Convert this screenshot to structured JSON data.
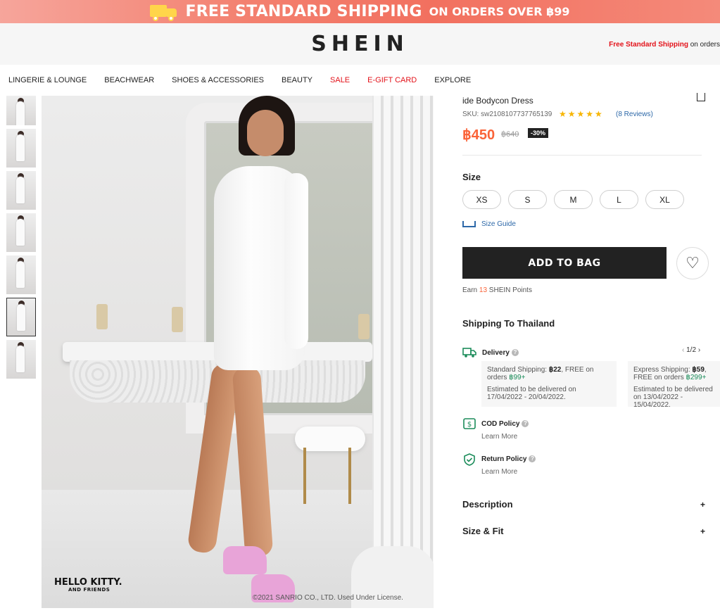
{
  "promo": {
    "main": "FREE STANDARD SHIPPING",
    "sub": "ON ORDERS OVER ฿99",
    "icon": "truck-icon",
    "accent": "#f2705f"
  },
  "header": {
    "logo": "SHEIN",
    "ship_red": "Free Standard Shipping",
    "ship_rest": " on orders"
  },
  "nav": [
    {
      "label": "LINGERIE & LOUNGE",
      "red": false
    },
    {
      "label": "BEACHWEAR",
      "red": false
    },
    {
      "label": "SHOES & ACCESSORIES",
      "red": false
    },
    {
      "label": "BEAUTY",
      "red": false
    },
    {
      "label": "SALE",
      "red": true
    },
    {
      "label": "E-GIFT CARD",
      "red": true
    },
    {
      "label": "EXPLORE",
      "red": false
    }
  ],
  "photo": {
    "brand": "HELLO KITTY.",
    "brand_sub": "AND FRIENDS",
    "copyright": "©2021 SANRIO CO., LTD. Used Under License."
  },
  "product": {
    "title": "ide Bodycon Dress",
    "sku": "SKU: sw2108107737765139",
    "stars": "★★★★★",
    "reviews": "(8 Reviews)",
    "price": "฿450",
    "old_price": "฿640",
    "discount": "-30%",
    "price_color": "#fa6338"
  },
  "size": {
    "label": "Size",
    "options": [
      "XS",
      "S",
      "M",
      "L",
      "XL"
    ],
    "guide": "Size Guide"
  },
  "actions": {
    "add_to_bag": "ADD TO BAG",
    "wishlist_icon": "heart-icon"
  },
  "points": {
    "prefix": "Earn ",
    "num": "13",
    "suffix": " SHEIN Points"
  },
  "shipping": {
    "title": "Shipping To Thailand",
    "delivery": {
      "label": "Delivery",
      "pager": "1/2",
      "cards": [
        {
          "type": "Standard Shipping: ",
          "cost": "฿22",
          "mid": ", FREE on orders ",
          "threshold": "฿99+",
          "estimate": "Estimated to be delivered on 17/04/2022 - 20/04/2022."
        },
        {
          "type": "Express Shipping: ",
          "cost": "฿59",
          "mid": ", FREE on orders ",
          "threshold": "฿299+",
          "estimate": "Estimated to be delivered on 13/04/2022 - 15/04/2022."
        }
      ]
    },
    "cod": {
      "label": "COD Policy",
      "link": "Learn More"
    },
    "return": {
      "label": "Return Policy",
      "link": "Learn More"
    }
  },
  "accordions": [
    {
      "label": "Description",
      "icon": "+"
    },
    {
      "label": "Size & Fit",
      "icon": "+"
    }
  ]
}
